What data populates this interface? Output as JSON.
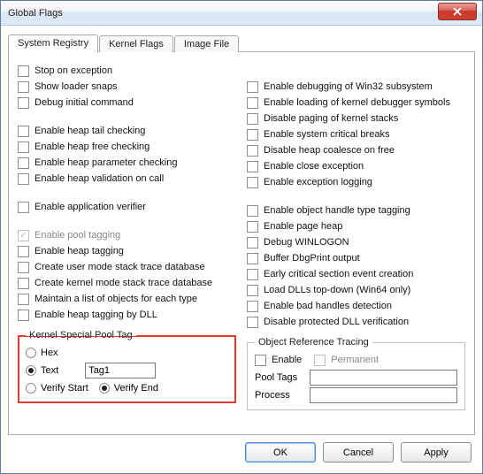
{
  "window": {
    "title": "Global Flags"
  },
  "tabs": {
    "system_registry": "System Registry",
    "kernel_flags": "Kernel Flags",
    "image_file": "Image File"
  },
  "left": {
    "stop_on_exception": "Stop on exception",
    "show_loader_snaps": "Show loader snaps",
    "debug_initial_command": "Debug initial command",
    "enable_heap_tail_checking": "Enable heap tail checking",
    "enable_heap_free_checking": "Enable heap free checking",
    "enable_heap_parameter_checking": "Enable heap parameter checking",
    "enable_heap_validation_on_call": "Enable heap validation on call",
    "enable_application_verifier": "Enable application verifier",
    "enable_pool_tagging": "Enable pool tagging",
    "enable_heap_tagging": "Enable heap tagging",
    "create_user_mode_stack_trace_database": "Create user mode stack trace database",
    "create_kernel_mode_stack_trace_database": "Create kernel mode stack trace database",
    "maintain_a_list_of_objects_for_each_type": "Maintain a list of objects for each type",
    "enable_heap_tagging_by_dll": "Enable heap tagging by DLL"
  },
  "right": {
    "enable_debugging_of_win32_subsystem": "Enable debugging of Win32 subsystem",
    "enable_loading_of_kernel_debugger_symbols": "Enable loading of kernel debugger symbols",
    "disable_paging_of_kernel_stacks": "Disable paging of kernel stacks",
    "enable_system_critical_breaks": "Enable system critical breaks",
    "disable_heap_coalesce_on_free": "Disable heap coalesce on free",
    "enable_close_exception": "Enable close exception",
    "enable_exception_logging": "Enable exception logging",
    "enable_object_handle_type_tagging": "Enable object handle type tagging",
    "enable_page_heap": "Enable page heap",
    "debug_winlogon": "Debug WINLOGON",
    "buffer_dbgprint_output": "Buffer DbgPrint output",
    "early_critical_section_event_creation": "Early critical section event creation",
    "load_dlls_top_down": "Load DLLs top-down (Win64 only)",
    "enable_bad_handles_detection": "Enable bad handles detection",
    "disable_protected_dll_verification": "Disable protected DLL verification"
  },
  "kspt": {
    "legend": "Kernel Special Pool Tag",
    "hex": "Hex",
    "text": "Text",
    "value": "Tag1",
    "verify_start": "Verify Start",
    "verify_end": "Verify End"
  },
  "ort": {
    "legend": "Object Reference Tracing",
    "enable": "Enable",
    "permanent": "Permanent",
    "pool_tags_label": "Pool Tags",
    "pool_tags_value": "",
    "process_label": "Process",
    "process_value": ""
  },
  "buttons": {
    "ok": "OK",
    "cancel": "Cancel",
    "apply": "Apply"
  }
}
